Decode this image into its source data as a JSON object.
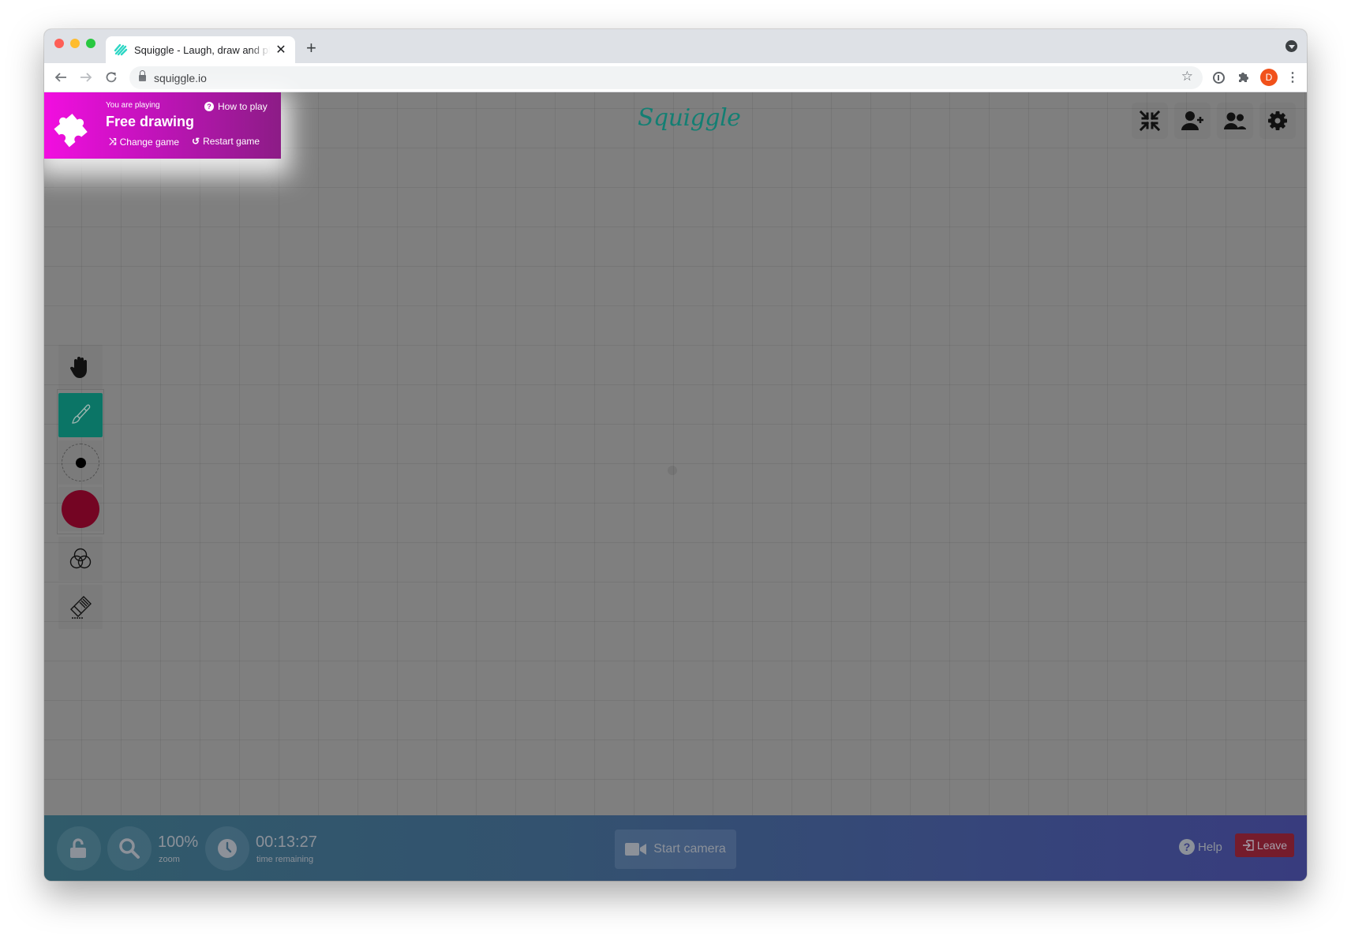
{
  "browser": {
    "tab": {
      "title": "Squiggle - Laugh, draw and play with friends",
      "favicon": "squiggle-favicon"
    },
    "new_tab_label": "+",
    "close_tab_label": "✕",
    "url": "squiggle.io",
    "profile_initial": "D",
    "colors": {
      "profile": "#f1511b"
    }
  },
  "banner": {
    "pre_label": "You are playing",
    "game_name": "Free drawing",
    "how_to_play": "How to play",
    "change_game": "Change game",
    "restart_game": "Restart game",
    "icon": "puzzle-icon",
    "colors": {
      "from": "#f20ee0",
      "to": "#8c1c86"
    }
  },
  "logo": {
    "text": "Squiggle",
    "color": "#137f73"
  },
  "top_actions": [
    {
      "name": "exit-fullscreen",
      "icon": "compress-icon"
    },
    {
      "name": "invite-player",
      "icon": "user-plus-icon"
    },
    {
      "name": "players",
      "icon": "users-icon"
    },
    {
      "name": "settings",
      "icon": "gear-icon"
    }
  ],
  "tools": {
    "items": [
      "hand",
      "brush",
      "brush-size",
      "color",
      "palette",
      "eraser"
    ],
    "active": "brush",
    "active_color": "#0b7566",
    "brush_color": "#740523"
  },
  "bottom_bar": {
    "zoom_value": "100%",
    "zoom_label": "zoom",
    "time_value": "00:13:27",
    "time_label": "time remaining",
    "camera_label": "Start camera",
    "help_label": "Help",
    "leave_label": "Leave",
    "colors": {
      "leave": "#751c2c"
    }
  }
}
